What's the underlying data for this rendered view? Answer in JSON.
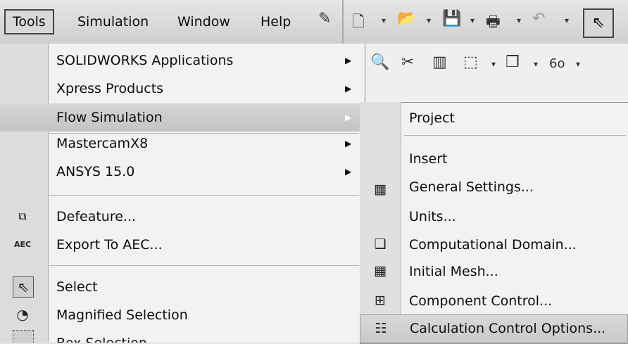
{
  "menubar": {
    "items": [
      "Tools",
      "Simulation",
      "Window",
      "Help"
    ]
  },
  "tools_menu": {
    "items": [
      {
        "label": "SOLIDWORKS Applications",
        "submenu": true
      },
      {
        "label": "Xpress Products",
        "submenu": true
      },
      {
        "label": "Flow Simulation",
        "submenu": true
      },
      {
        "label": "MastercamX8",
        "submenu": true
      },
      {
        "label": "ANSYS 15.0",
        "submenu": true
      },
      {
        "label": "Defeature...",
        "submenu": false
      },
      {
        "label": "Export To AEC...",
        "submenu": false
      },
      {
        "label": "Select",
        "submenu": false
      },
      {
        "label": "Magnified Selection",
        "submenu": false
      },
      {
        "label": "Box Selection",
        "submenu": false
      }
    ]
  },
  "flow_menu": {
    "items": [
      {
        "label": "Project"
      },
      {
        "label": "Insert"
      },
      {
        "label": "General Settings..."
      },
      {
        "label": "Units..."
      },
      {
        "label": "Computational Domain..."
      },
      {
        "label": "Initial Mesh..."
      },
      {
        "label": "Component Control..."
      },
      {
        "label": "Calculation Control Options..."
      }
    ]
  },
  "icons": {
    "submenu_arrow": "▶",
    "dropdown_arrow": "▾"
  }
}
